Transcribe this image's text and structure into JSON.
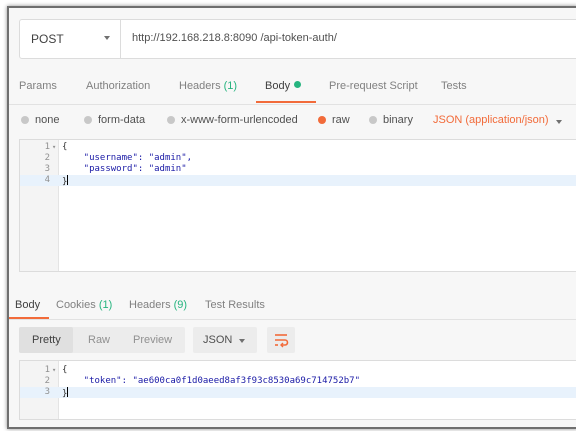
{
  "request": {
    "method": "POST",
    "url": "http://192.168.218.8:8090 /api-token-auth/"
  },
  "req_tabs": [
    {
      "label": "Params"
    },
    {
      "label": "Authorization"
    },
    {
      "label": "Headers",
      "count": "(1)"
    },
    {
      "label": "Body"
    },
    {
      "label": "Pre-request Script"
    },
    {
      "label": "Tests"
    }
  ],
  "body_types": {
    "none": "none",
    "form_data": "form-data",
    "urlencoded": "x-www-form-urlencoded",
    "raw": "raw",
    "binary": "binary",
    "selected": "raw",
    "content_type": "JSON (application/json)"
  },
  "request_body": {
    "lines": [
      {
        "n": "1",
        "fold": "▾",
        "text": "{"
      },
      {
        "n": "2",
        "text": "    \"username\": \"admin\","
      },
      {
        "n": "3",
        "text": "    \"password\": \"admin\""
      },
      {
        "n": "4",
        "text": "}"
      }
    ]
  },
  "resp_tabs": [
    {
      "label": "Body"
    },
    {
      "label": "Cookies",
      "count": "(1)"
    },
    {
      "label": "Headers",
      "count": "(9)"
    },
    {
      "label": "Test Results"
    }
  ],
  "format": {
    "pretty": "Pretty",
    "raw": "Raw",
    "preview": "Preview",
    "language": "JSON"
  },
  "response_body": {
    "lines": [
      {
        "n": "1",
        "fold": "▾",
        "text": "{"
      },
      {
        "n": "2",
        "text": "    \"token\": \"ae600ca0f1d0aeed8af3f93c8530a69c714752b7\""
      },
      {
        "n": "3",
        "text": "}"
      }
    ]
  },
  "colors": {
    "accent": "#f26b3a",
    "count_green": "#26b47f"
  }
}
